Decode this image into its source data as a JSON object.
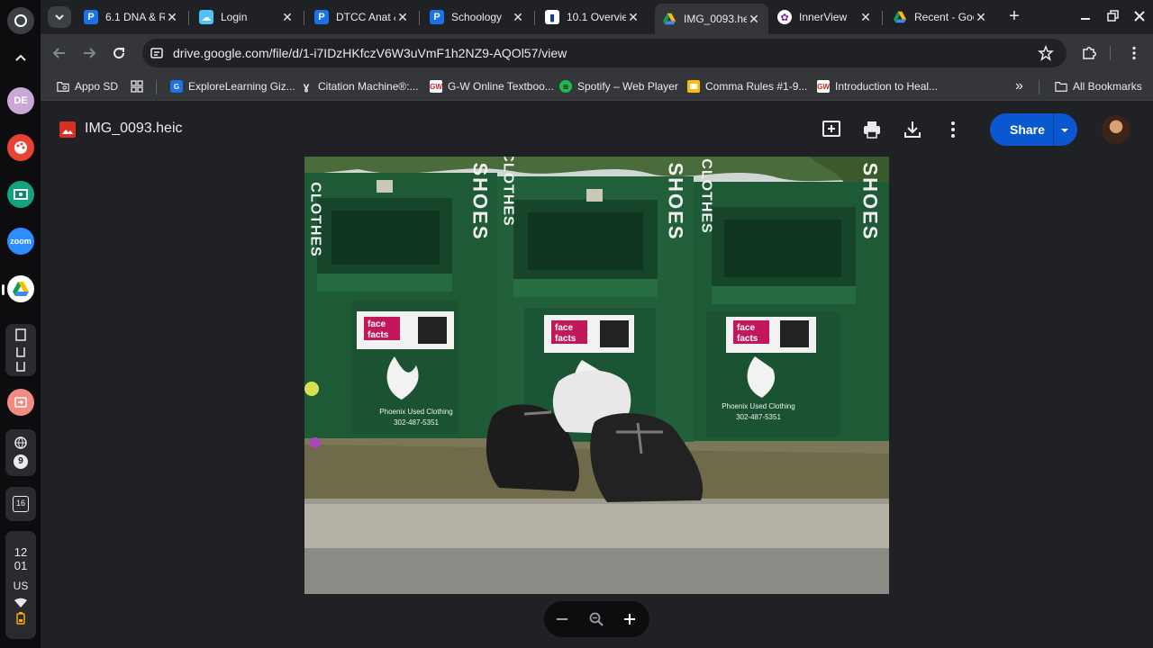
{
  "shelf": {
    "apps": [
      {
        "name": "launcher",
        "icon": "circle-icon"
      },
      {
        "name": "profile",
        "label": "DE"
      },
      {
        "name": "palette",
        "icon": "palette-icon"
      },
      {
        "name": "classroom",
        "icon": "classroom-icon"
      },
      {
        "name": "zoom",
        "label": "zoom"
      },
      {
        "name": "google-drive",
        "icon": "drive-icon"
      }
    ],
    "calendar_day": "16",
    "notification_count": "9",
    "clock_hour": "12",
    "clock_minute": "01",
    "locale": "US"
  },
  "tabs": [
    {
      "title": "6.1 DNA & R",
      "favicon": "pearson-icon",
      "active": false
    },
    {
      "title": "Login",
      "favicon": "cloud-icon",
      "active": false
    },
    {
      "title": "DTCC Anat &",
      "favicon": "pearson-icon",
      "active": false
    },
    {
      "title": "Schoology",
      "favicon": "pearson-icon",
      "active": false
    },
    {
      "title": "10.1 Overvie",
      "favicon": "book-icon",
      "active": false
    },
    {
      "title": "IMG_0093.he",
      "favicon": "drive-icon",
      "active": true
    },
    {
      "title": "InnerView",
      "favicon": "innerview-icon",
      "active": false
    },
    {
      "title": "Recent - Goo",
      "favicon": "drive-icon",
      "active": false
    }
  ],
  "toolbar": {
    "url": "drive.google.com/file/d/1-i7IDzHKfczV6W3uVmF1h2NZ9-AQOl57/view"
  },
  "bookmarks": {
    "items": [
      {
        "label": "Appo SD",
        "icon": "folder-search-icon"
      },
      {
        "label": "",
        "icon": "apps-grid-icon"
      },
      {
        "label": "ExploreLearning Giz...",
        "icon": "gizmos-icon"
      },
      {
        "label": "Citation Machine®:...",
        "icon": "citation-icon"
      },
      {
        "label": "G-W Online Textboo...",
        "icon": "gw-icon"
      },
      {
        "label": "Spotify – Web Player",
        "icon": "spotify-icon"
      },
      {
        "label": "Comma Rules #1-9...",
        "icon": "slides-icon"
      },
      {
        "label": "Introduction to Heal...",
        "icon": "gw-icon"
      }
    ],
    "all_label": "All Bookmarks"
  },
  "viewer": {
    "filename": "IMG_0093.heic",
    "share_label": "Share",
    "photo": {
      "bin_words": [
        "SHOES",
        "CLOTHES"
      ],
      "sticker_brand_top": "face",
      "sticker_brand_bottom": "facts",
      "company_name": "Phoenix Used Clothing",
      "company_phone": "302-487-5351"
    }
  },
  "colors": {
    "accent": "#0b57d0",
    "bin_green": "#1f5a37",
    "background": "#202124"
  }
}
